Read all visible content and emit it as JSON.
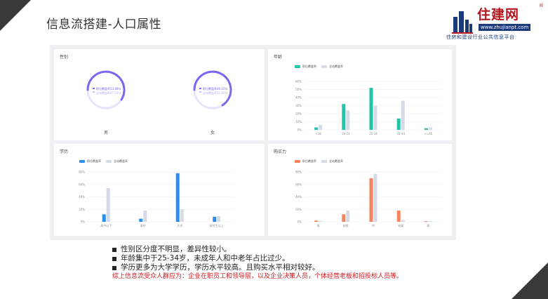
{
  "title": "信息流搭建-人口属性",
  "logo": {
    "name": "住建网",
    "url": "www.zhujianpt.com",
    "slogan": "住房和建设行业公共信息平台",
    "reg": "®"
  },
  "panels": {
    "gender": {
      "title": "性别",
      "legend_pct_a": "职位覆盖率53.88%",
      "legend_pct_b": "全站覆盖率47.15%",
      "legend_pct_c": "职位覆盖率46.12%",
      "legend_pct_d": "全站覆盖率52.85%",
      "male_label": "男",
      "female_label": "女"
    },
    "age": {
      "title": "年龄",
      "legend_a": "职位覆盖率",
      "legend_b": "全站覆盖率"
    },
    "education": {
      "title": "学历",
      "legend_a": "职位覆盖率",
      "legend_b": "全站覆盖率"
    },
    "purchasing": {
      "title": "购买力",
      "legend_a": "职位覆盖率",
      "legend_b": "全站覆盖率"
    }
  },
  "chart_data": [
    {
      "type": "bar",
      "title": "年龄",
      "categories": [
        "<18",
        "18-24",
        "25-34",
        "35-44",
        ">=45"
      ],
      "series": [
        {
          "name": "职位覆盖率",
          "values": [
            3,
            32,
            52,
            14,
            2
          ]
        },
        {
          "name": "全站覆盖率",
          "values": [
            6,
            24,
            30,
            36,
            3
          ]
        }
      ],
      "yticks": [
        "0%",
        "10%",
        "20%",
        "30%",
        "40%",
        "50%",
        "60%"
      ],
      "ylim": [
        0,
        60
      ],
      "colors": [
        "#22c3a6",
        "#d5dbe6"
      ]
    },
    {
      "type": "bar",
      "title": "学历",
      "categories": [
        "高中以下",
        "高中",
        "大学",
        "研究生以上"
      ],
      "series": [
        {
          "name": "职位覆盖率",
          "values": [
            12,
            5,
            78,
            8
          ]
        },
        {
          "name": "全站覆盖率",
          "values": [
            54,
            18,
            20,
            9
          ]
        }
      ],
      "yticks": [
        "0%",
        "20%",
        "40%",
        "60%",
        "80%"
      ],
      "ylim": [
        0,
        80
      ],
      "colors": [
        "#2b8ef0",
        "#d5dbe6"
      ]
    },
    {
      "type": "bar",
      "title": "购买力",
      "categories": [
        "低",
        "较低",
        "中",
        "较高",
        "高"
      ],
      "series": [
        {
          "name": "职位覆盖率",
          "values": [
            2,
            12,
            70,
            18,
            1
          ]
        },
        {
          "name": "全站覆盖率",
          "values": [
            1,
            18,
            77,
            3,
            1
          ]
        }
      ],
      "yticks": [
        "0%",
        "20%",
        "40%",
        "60%",
        "80%"
      ],
      "ylim": [
        0,
        80
      ],
      "colors": [
        "#f5845f",
        "#d5dbe6"
      ]
    }
  ],
  "bullets": [
    "性别区分度不明显，差异性较小。",
    "年龄集中于25-34岁，未成年人和中老年占比过少。",
    "学历更多为大学学历，学历水平较高。且购买水平相对较好。"
  ],
  "conclusion": "综上信息流受众人群应为：企业在职员工和领导层，以及企业决策人员，个体经营老板和招投标人员等。",
  "colors": {
    "gauge": "#7b68ee",
    "gauge_track": "#e7e4fb",
    "red": "#d0191f",
    "dark": "#3a3a3a"
  }
}
